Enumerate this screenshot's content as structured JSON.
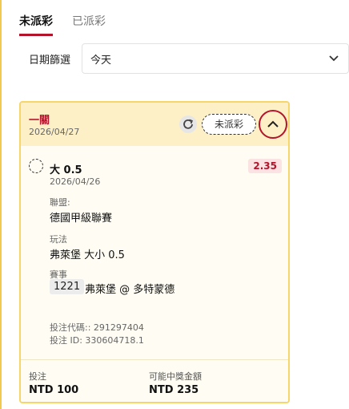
{
  "tabs": [
    {
      "label": "未派彩",
      "active": true
    },
    {
      "label": "已派彩",
      "active": false
    }
  ],
  "filter": {
    "label": "日期篩選",
    "selected": "今天"
  },
  "card": {
    "title": "一關",
    "date": "2026/04/27",
    "status": "未派彩",
    "selection": {
      "name": "大 0.5",
      "date": "2026/04/26",
      "odds": "2.35"
    },
    "league": {
      "label": "聯盟:",
      "value": "德國甲級聯賽"
    },
    "market": {
      "label": "玩法",
      "value": "弗萊堡 大小 0.5"
    },
    "event": {
      "label": "賽事",
      "id": "1221",
      "name": "弗萊堡 @ 多特蒙德"
    },
    "bet_code": "投注代碼:: 291297404",
    "bet_id": "投注 ID: 330604718.1",
    "stake": {
      "label": "投注",
      "value": "NTD 100"
    },
    "payout": {
      "label": "可能中獎金額",
      "value": "NTD 235"
    }
  },
  "colors": {
    "accent": "#b3142b",
    "card_border": "#f6d66b",
    "card_header": "#fdf0c7"
  },
  "icons": [
    "refresh-icon",
    "chevron-up-icon",
    "chevron-down-icon"
  ]
}
